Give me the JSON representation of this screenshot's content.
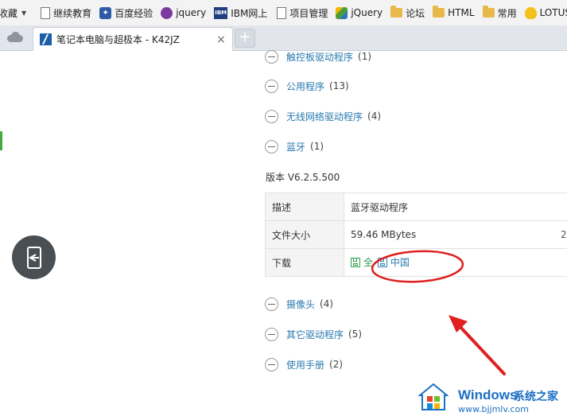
{
  "bookmarks": [
    {
      "label": "收藏",
      "icon": "dropdown"
    },
    {
      "label": "继续教育",
      "icon": "page-icon"
    },
    {
      "label": "百度经验",
      "icon": "paw-icon"
    },
    {
      "label": "jquery",
      "icon": "gear-icon"
    },
    {
      "label": "IBM网上",
      "icon": "ibm-icon"
    },
    {
      "label": "项目管理",
      "icon": "page-icon"
    },
    {
      "label": "jQuery",
      "icon": "jquery-icon"
    },
    {
      "label": "论坛",
      "icon": "folder-icon"
    },
    {
      "label": "HTML",
      "icon": "folder-icon"
    },
    {
      "label": "常用",
      "icon": "folder-icon"
    },
    {
      "label": "LOTUS",
      "icon": "lotus-icon"
    }
  ],
  "tab": {
    "title": "笔记本电脑与超极本 - K42JZ",
    "close": "×"
  },
  "newtab": "+",
  "categories_top": [
    {
      "label": "触控板驱动程序",
      "count": "(1)"
    },
    {
      "label": "公用程序",
      "count": "(13)"
    },
    {
      "label": "无线网络驱动程序",
      "count": "(4)"
    },
    {
      "label": "蓝牙",
      "count": "(1)"
    }
  ],
  "version": "版本 V6.2.5.500",
  "table": {
    "desc_key": "描述",
    "desc_val": "蓝牙驱动程序",
    "size_key": "文件大小",
    "size_val": "59.46 MBytes",
    "size_extra": "2",
    "download_key": "下载",
    "download_global": "全",
    "download_china": "中国"
  },
  "categories_bottom": [
    {
      "label": "摄像头",
      "count": "(4)"
    },
    {
      "label": "其它驱动程序",
      "count": "(5)"
    },
    {
      "label": "使用手册",
      "count": "(2)"
    }
  ],
  "watermark": {
    "brand": "Windows",
    "cn": "系统之家",
    "url": "www.bjjmlv.com"
  },
  "colors": {
    "link": "#2a7ab0",
    "annotation": "#e02020",
    "watermark": "#1b6fc4"
  }
}
